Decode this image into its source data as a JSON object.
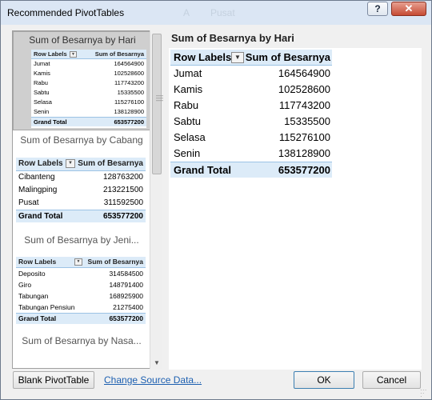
{
  "window": {
    "title": "Recommended PivotTables",
    "ghost_text_1": "A",
    "ghost_text_2": "Pusat",
    "help_label": "?",
    "close_label": "✕"
  },
  "thumbnails": [
    {
      "title": "Sum of Besarnya by Hari",
      "header": [
        "Row Labels",
        "Sum of Besarnya"
      ],
      "rows": [
        [
          "Jumat",
          "164564900"
        ],
        [
          "Kamis",
          "102528600"
        ],
        [
          "Rabu",
          "117743200"
        ],
        [
          "Sabtu",
          "15335500"
        ],
        [
          "Selasa",
          "115276100"
        ],
        [
          "Senin",
          "138128900"
        ]
      ],
      "total": [
        "Grand Total",
        "653577200"
      ]
    },
    {
      "title": "Sum of Besarnya by Cabang",
      "header": [
        "Row Labels",
        "Sum of Besarnya"
      ],
      "rows": [
        [
          "Cibanteng",
          "128763200"
        ],
        [
          "Malingping",
          "213221500"
        ],
        [
          "Pusat",
          "311592500"
        ]
      ],
      "total": [
        "Grand Total",
        "653577200"
      ]
    },
    {
      "title": "Sum of Besarnya by Jeni...",
      "header": [
        "Row Labels",
        "Sum of Besarnya"
      ],
      "rows": [
        [
          "Deposito",
          "314584500"
        ],
        [
          "Giro",
          "148791400"
        ],
        [
          "Tabungan",
          "168925900"
        ],
        [
          "Tabungan Pensiun",
          "21275400"
        ]
      ],
      "total": [
        "Grand Total",
        "653577200"
      ]
    },
    {
      "title": "Sum of Besarnya by Nasa..."
    }
  ],
  "preview": {
    "title": "Sum of Besarnya by Hari",
    "header": [
      "Row Labels",
      "Sum of Besarnya"
    ],
    "rows": [
      [
        "Jumat",
        "164564900"
      ],
      [
        "Kamis",
        "102528600"
      ],
      [
        "Rabu",
        "117743200"
      ],
      [
        "Sabtu",
        "15335500"
      ],
      [
        "Selasa",
        "115276100"
      ],
      [
        "Senin",
        "138128900"
      ]
    ],
    "total": [
      "Grand Total",
      "653577200"
    ]
  },
  "footer": {
    "blank_label": "Blank PivotTable",
    "change_source_label": "Change Source Data...",
    "ok_label": "OK",
    "cancel_label": "Cancel"
  },
  "colors": {
    "header_fill": "#dcebf8",
    "header_border": "#9cc3e5",
    "link": "#1c5fb0"
  }
}
